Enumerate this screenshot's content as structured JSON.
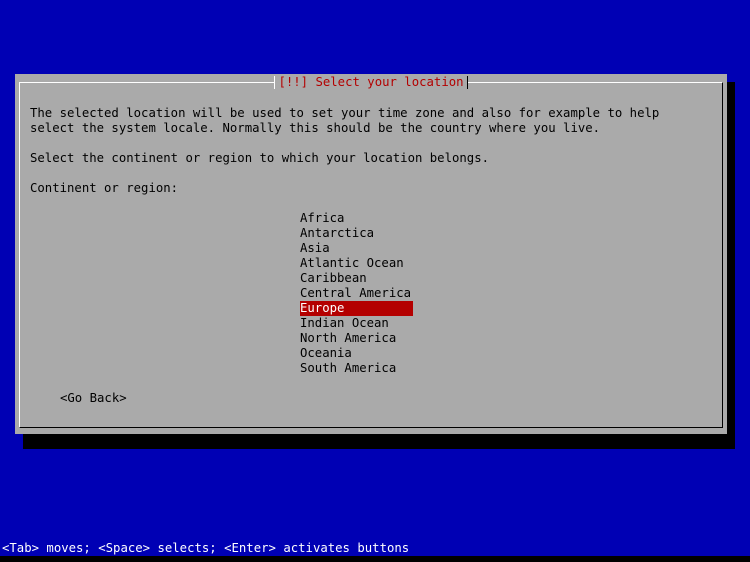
{
  "dialog": {
    "title": "[!!] Select your location",
    "description_line1": "The selected location will be used to set your time zone and also for example to help",
    "description_line2": "select the system locale. Normally this should be the country where you live.",
    "instruction": "Select the continent or region to which your location belongs.",
    "field_label": "Continent or region:",
    "regions": [
      {
        "label": "Africa"
      },
      {
        "label": "Antarctica"
      },
      {
        "label": "Asia"
      },
      {
        "label": "Atlantic Ocean"
      },
      {
        "label": "Caribbean"
      },
      {
        "label": "Central America"
      },
      {
        "label": "Europe"
      },
      {
        "label": "Indian Ocean"
      },
      {
        "label": "North America"
      },
      {
        "label": "Oceania"
      },
      {
        "label": "South America"
      }
    ],
    "selected_region": "Europe",
    "go_back_label": "<Go Back>"
  },
  "statusbar": {
    "text": "<Tab> moves; <Space> selects; <Enter> activates buttons"
  },
  "colors": {
    "background": "#0000b4",
    "dialog": "#aaaaaa",
    "highlight": "#b40000",
    "title_text": "#b40000"
  }
}
